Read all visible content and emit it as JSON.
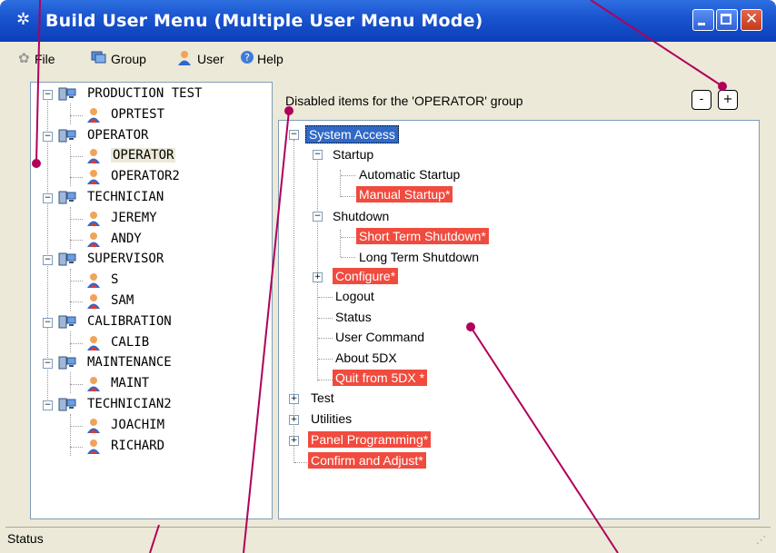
{
  "window": {
    "title": "Build User Menu (Multiple User Menu Mode)"
  },
  "menu": [
    "File",
    "Group",
    "User",
    "Help"
  ],
  "groups": [
    {
      "name": "PRODUCTION TEST",
      "users": [
        "OPRTEST"
      ]
    },
    {
      "name": "OPERATOR",
      "users": [
        "OPERATOR",
        "OPERATOR2"
      ]
    },
    {
      "name": "TECHNICIAN",
      "users": [
        "JEREMY",
        "ANDY"
      ]
    },
    {
      "name": "SUPERVISOR",
      "users": [
        "S",
        "SAM"
      ]
    },
    {
      "name": "CALIBRATION",
      "users": [
        "CALIB"
      ]
    },
    {
      "name": "MAINTENANCE",
      "users": [
        "MAINT"
      ]
    },
    {
      "name": "TECHNICIAN2",
      "users": [
        "JOACHIM",
        "RICHARD"
      ]
    }
  ],
  "right": {
    "header": "Disabled items for the 'OPERATOR' group",
    "collapse_label": "-",
    "expand_label": "+"
  },
  "menu_tree": {
    "system_access": "System Access",
    "startup": "Startup",
    "automatic_startup": "Automatic Startup",
    "manual_startup": "Manual Startup*",
    "shutdown": "Shutdown",
    "short_term_shutdown": "Short Term Shutdown*",
    "long_term_shutdown": "Long Term Shutdown",
    "configure": "Configure*",
    "logout": "Logout",
    "status": "Status",
    "user_command": "User Command",
    "about": "About 5DX",
    "quit": "Quit from 5DX *",
    "test": "Test",
    "utilities": "Utilities",
    "panel_programming": "Panel Programming*",
    "confirm_adjust": "Confirm and Adjust*"
  },
  "status_bar": {
    "text": "Status"
  },
  "colors": {
    "disabled_item": "#f04b3e",
    "selected_item": "#3169c6",
    "annotation_line": "#b0005a"
  }
}
